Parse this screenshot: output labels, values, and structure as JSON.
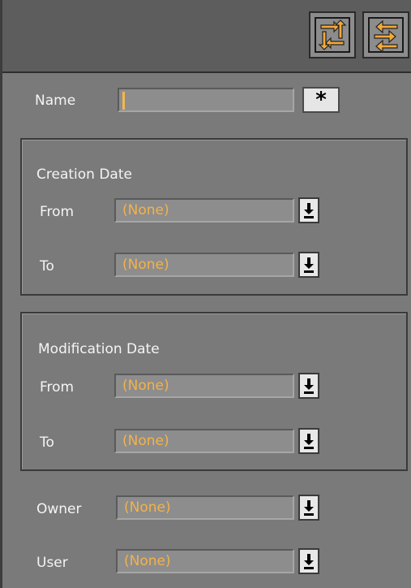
{
  "toolbar": {
    "buttons": [
      {
        "icon": "swap-arrows-icon"
      },
      {
        "icon": "transfer-arrows-icon"
      }
    ]
  },
  "name_filter": {
    "label": "Name",
    "value": "",
    "wildcard_label": "*"
  },
  "creation_date": {
    "title": "Creation Date",
    "from_label": "From",
    "from_value": "(None)",
    "to_label": "To",
    "to_value": "(None)"
  },
  "modification_date": {
    "title": "Modification Date",
    "from_label": "From",
    "from_value": "(None)",
    "to_label": "To",
    "to_value": "(None)"
  },
  "owner": {
    "label": "Owner",
    "value": "(None)"
  },
  "user": {
    "label": "User",
    "value": "(None)"
  },
  "colors": {
    "background": "#7a7a7a",
    "toolbar": "#5d5d5d",
    "value_text": "#f3b24a",
    "label_text": "#f4f4f4"
  }
}
